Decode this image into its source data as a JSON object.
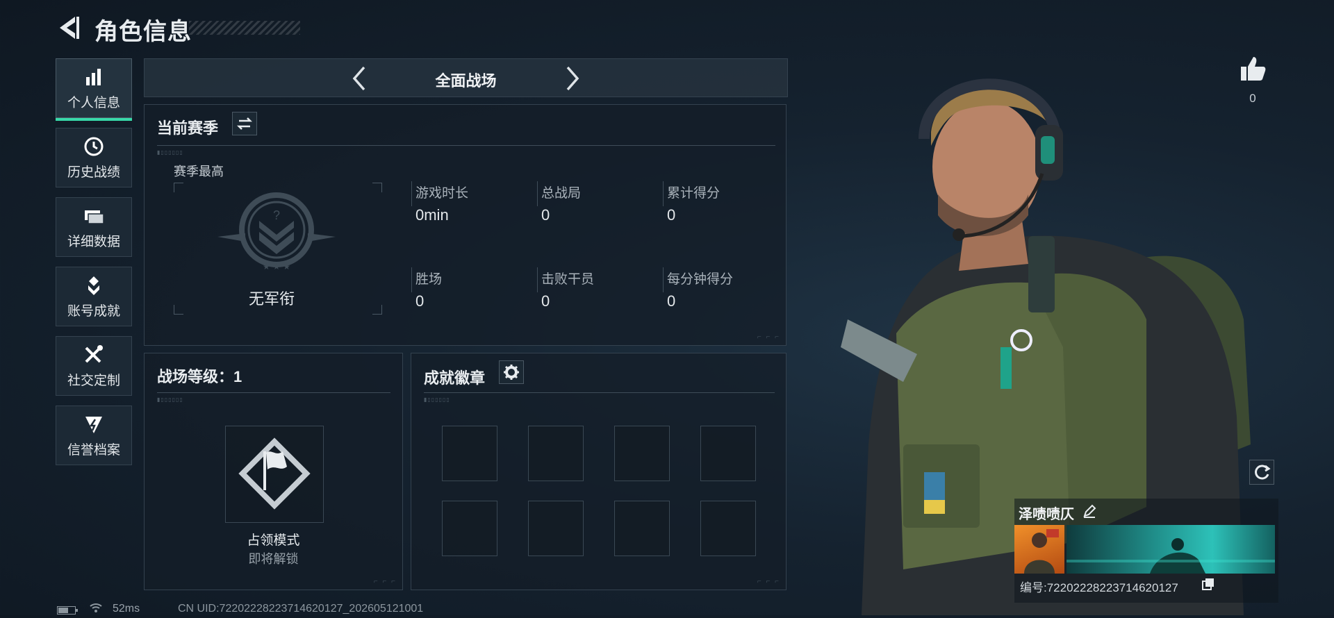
{
  "header": {
    "title": "角色信息"
  },
  "sidebar": {
    "items": [
      {
        "label": "个人信息",
        "icon": "bar-chart-icon",
        "active": true
      },
      {
        "label": "历史战绩",
        "icon": "history-clock-icon",
        "active": false
      },
      {
        "label": "详细数据",
        "icon": "folder-data-icon",
        "active": false
      },
      {
        "label": "账号成就",
        "icon": "achievement-medal-icon",
        "active": false
      },
      {
        "label": "社交定制",
        "icon": "tools-wrench-icon",
        "active": false
      },
      {
        "label": "信誉档案",
        "icon": "shield-badge-icon",
        "active": false
      }
    ]
  },
  "mode_bar": {
    "label": "全面战场"
  },
  "season": {
    "title": "当前赛季",
    "best_label": "赛季最高",
    "rank_name": "无军衔",
    "stats": [
      {
        "label": "游戏时长",
        "value": "0min"
      },
      {
        "label": "总战局",
        "value": "0"
      },
      {
        "label": "累计得分",
        "value": "0"
      },
      {
        "label": "胜场",
        "value": "0"
      },
      {
        "label": "击败干员",
        "value": "0"
      },
      {
        "label": "每分钟得分",
        "value": "0"
      }
    ]
  },
  "level": {
    "title": "战场等级：1",
    "mode_name": "占领模式",
    "mode_status": "即将解锁"
  },
  "badges": {
    "title": "成就徽章",
    "slot_count": 8
  },
  "player": {
    "likes": "0",
    "name": "泽啧啧仄",
    "uid_line": "编号:7220222822371462012​7"
  },
  "footer": {
    "ping": "52ms",
    "cn_uid": "CN UID:7220222822371462012​7_202605121001"
  },
  "colors": {
    "accent": "#38d9a9",
    "panel_border": "#34424f"
  }
}
